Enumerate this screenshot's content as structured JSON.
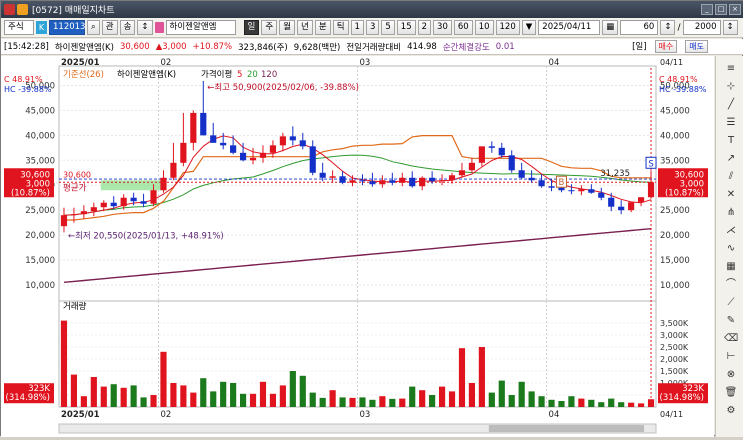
{
  "window": {
    "title": "[0572] 매매일지차트",
    "controls": [
      "_",
      "□",
      "×"
    ]
  },
  "toolbar": {
    "market_label": "주식",
    "code_badge": "K",
    "code_value": "112013",
    "search_label": "관",
    "updown_label": "송",
    "stock_name": "하이젠알앤엠",
    "period_selected": "일",
    "periods": [
      "주",
      "월",
      "년",
      "분",
      "틱"
    ],
    "intervals": [
      "1",
      "3",
      "5",
      "15",
      "2",
      "30",
      "60",
      "10",
      "120"
    ],
    "date": "2025/04/11",
    "count": "60",
    "slash": "/",
    "total": "2000"
  },
  "infobar": {
    "time": "[15:42:28]",
    "stock": "하이젠알앤엠(K)",
    "price": "30,600",
    "change": "▲3,000",
    "change_pct": "+10.87%",
    "volume": "323,846(주)",
    "amount": "9,628(백만)",
    "prev_vol_label": "전일거래량대비",
    "prev_vol_value": "414.98",
    "strength_label": "순간체결강도",
    "strength_value": "0.01",
    "period_badge": "[일]",
    "buy_label": "매수",
    "sell_label": "매도"
  },
  "colors": {
    "up": "#e0141e",
    "down": "#1430c8",
    "ma5": "#e0141e",
    "ma20": "#2e9a2e",
    "ma120": "#7a1f4f",
    "baseline": "#e06a1a"
  },
  "chart_data": {
    "type": "candlestick",
    "dates": [
      "2025/01/13",
      "2025/01/14",
      "2025/01/15",
      "2025/01/16",
      "2025/01/17",
      "2025/01/20",
      "2025/01/21",
      "2025/01/22",
      "2025/01/23",
      "2025/01/24",
      "2025/01/31",
      "2025/02/03",
      "2025/02/04",
      "2025/02/05",
      "2025/02/06",
      "2025/02/07",
      "2025/02/10",
      "2025/02/11",
      "2025/02/12",
      "2025/02/13",
      "2025/02/14",
      "2025/02/17",
      "2025/02/18",
      "2025/02/19",
      "2025/02/20",
      "2025/02/21",
      "2025/02/24",
      "2025/02/25",
      "2025/02/26",
      "2025/02/27",
      "2025/02/28",
      "2025/03/04",
      "2025/03/05",
      "2025/03/06",
      "2025/03/07",
      "2025/03/10",
      "2025/03/11",
      "2025/03/12",
      "2025/03/13",
      "2025/03/14",
      "2025/03/17",
      "2025/03/18",
      "2025/03/19",
      "2025/03/20",
      "2025/03/21",
      "2025/03/24",
      "2025/03/25",
      "2025/03/26",
      "2025/03/27",
      "2025/03/28",
      "2025/03/31",
      "2025/04/01",
      "2025/04/02",
      "2025/04/03",
      "2025/04/04",
      "2025/04/07",
      "2025/04/08",
      "2025/04/09",
      "2025/04/10",
      "2025/04/11"
    ],
    "open": [
      21800,
      24000,
      24200,
      24800,
      25600,
      26500,
      25800,
      27500,
      26800,
      26300,
      29000,
      31500,
      34500,
      38500,
      44500,
      40000,
      38500,
      38000,
      36500,
      35000,
      35500,
      36500,
      38000,
      39800,
      39000,
      37800,
      32500,
      31500,
      31800,
      30500,
      31000,
      30800,
      30200,
      31000,
      30500,
      31500,
      29800,
      31500,
      30800,
      31000,
      32000,
      33000,
      34500,
      37800,
      37500,
      36000,
      33000,
      31500,
      31000,
      29800,
      29500,
      29000,
      28800,
      29200,
      28500,
      27500,
      25700,
      25000,
      26600,
      27600
    ],
    "high": [
      25500,
      25500,
      26000,
      26500,
      27000,
      27800,
      28200,
      28500,
      28300,
      30200,
      33000,
      38500,
      44500,
      45000,
      50900,
      42500,
      40500,
      40000,
      38500,
      37500,
      38000,
      39000,
      40500,
      41800,
      40500,
      39000,
      34500,
      33000,
      32800,
      32000,
      32200,
      32500,
      32000,
      32500,
      32500,
      32800,
      31800,
      32800,
      32200,
      32500,
      34500,
      35500,
      36500,
      38800,
      38500,
      37000,
      34500,
      33000,
      32200,
      31200,
      30500,
      30200,
      30000,
      30200,
      29500,
      28500,
      27000,
      26200,
      27600,
      33000
    ],
    "low": [
      20550,
      22500,
      23300,
      23800,
      24800,
      25200,
      25100,
      26000,
      25600,
      25800,
      28500,
      31000,
      33800,
      37000,
      40000,
      38800,
      37200,
      36200,
      34800,
      34200,
      34500,
      35500,
      36800,
      38000,
      37200,
      32000,
      30800,
      30500,
      30200,
      29800,
      30000,
      29700,
      29500,
      30000,
      29800,
      29500,
      29000,
      30300,
      30000,
      30300,
      31500,
      32500,
      33800,
      36500,
      35500,
      32500,
      31200,
      30500,
      29500,
      28800,
      28600,
      28200,
      28000,
      28300,
      27000,
      24800,
      24200,
      24600,
      25800,
      27300
    ],
    "close": [
      24000,
      24200,
      24800,
      25600,
      26500,
      25800,
      27500,
      26800,
      26300,
      29000,
      31500,
      34500,
      38500,
      44500,
      40000,
      38500,
      38000,
      36500,
      35000,
      35500,
      36500,
      38000,
      39800,
      39000,
      37800,
      32500,
      31500,
      31800,
      30500,
      31000,
      30800,
      30200,
      31000,
      30500,
      31500,
      29800,
      31500,
      30800,
      31000,
      32000,
      33000,
      34500,
      37800,
      37500,
      36000,
      33000,
      31500,
      31000,
      29800,
      29500,
      29000,
      28800,
      29200,
      28500,
      27500,
      25700,
      25000,
      26600,
      27600,
      30600
    ],
    "volume": [
      3600000,
      1350000,
      450000,
      1250000,
      850000,
      950000,
      800000,
      900000,
      400000,
      500000,
      2300000,
      1000000,
      900000,
      600000,
      1200000,
      650000,
      1050000,
      1000000,
      550000,
      550000,
      1050000,
      550000,
      900000,
      1500000,
      1300000,
      600000,
      380000,
      700000,
      400000,
      380000,
      400000,
      300000,
      450000,
      340000,
      350000,
      850000,
      700000,
      500000,
      850000,
      650000,
      2450000,
      1000000,
      2500000,
      600000,
      1100000,
      500000,
      1050000,
      650000,
      450000,
      300000,
      250000,
      450000,
      350000,
      300000,
      200000,
      350000,
      200000,
      180000,
      150000,
      323846
    ],
    "ma120_start": 10550,
    "ma120_end": 21300,
    "price_labels": [
      "50,000",
      "45,000",
      "40,000",
      "35,000",
      "30,000",
      "25,000",
      "20,000",
      "15,000",
      "10,000"
    ],
    "price_ticks": [
      50000,
      45000,
      40000,
      35000,
      30000,
      25000,
      20000,
      15000,
      10000
    ],
    "volume_labels": [
      "3,500K",
      "3,000K",
      "2,500K",
      "2,000K",
      "1,500K",
      "1,000K",
      "500K"
    ],
    "volume_ticks": [
      3500000,
      3000000,
      2500000,
      2000000,
      1500000,
      1000000,
      500000
    ],
    "month_labels": [
      "2025/01",
      "02",
      "03",
      "04"
    ],
    "month_starts": [
      0,
      10,
      30,
      49
    ],
    "ylim": [
      7000,
      53500
    ],
    "vlim": [
      0,
      4000000
    ],
    "legend_baseline": "기준선(26)",
    "legend_stock": "하이젠알앤엠(K)",
    "legend_ma": "가격이평",
    "legend_ma5": "5",
    "legend_ma20": "20",
    "legend_ma120": "120",
    "high_annotation": "←최고 50,900(2025/02/06, -39.88%)",
    "low_annotation": "←최저 20,550(2025/01/13, +48.91%)",
    "last_price": "30,600",
    "prev_close": "3,000",
    "change_pct_label": "(10.87%)",
    "ref_price_label": "31,235",
    "avg_label": "평균가",
    "left_marker_price": "30,600",
    "c_label": "C 48.91%",
    "hc_label": "HC -39.88%",
    "volume_title": "거래량",
    "volume_last": "323K",
    "volume_pct": "(314.98%)",
    "last_date_label": "04/11",
    "buy_marker": "B",
    "sell_marker": "S"
  },
  "tools": [
    "stack-icon",
    "crosshair-icon",
    "line-icon",
    "fib-icon",
    "text-icon",
    "arrow-icon",
    "channel-icon",
    "cross-icon",
    "pitchfork-icon",
    "fan-icon",
    "wave-icon",
    "gann-icon",
    "curve-icon",
    "zigzag-icon",
    "pencil-icon",
    "eraser-icon",
    "ruler-icon",
    "magnet-icon",
    "trash-icon",
    "settings-icon"
  ]
}
